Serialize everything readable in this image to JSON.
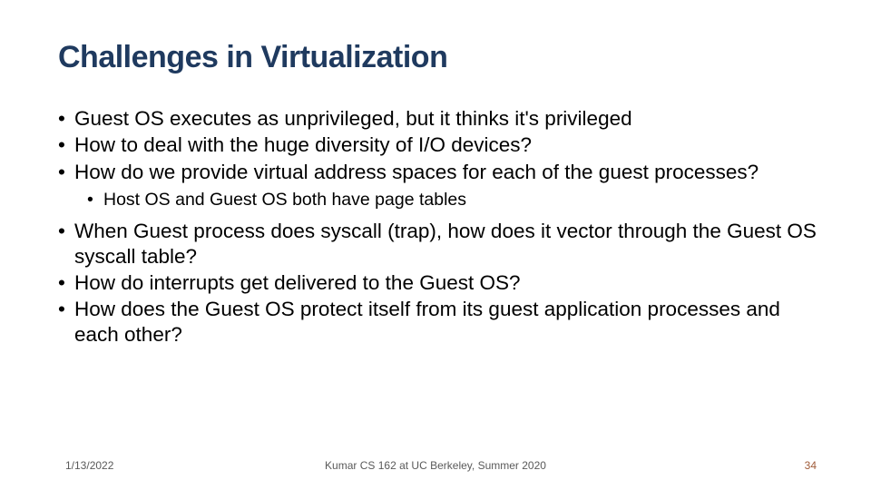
{
  "title": "Challenges in Virtualization",
  "bullets": {
    "b1": "Guest OS executes as unprivileged, but it thinks it's privileged",
    "b2": "How to deal with the huge diversity of I/O devices?",
    "b3": "How do we provide virtual address spaces for each of the guest processes?",
    "b3a": "Host OS and Guest OS both have page tables",
    "b4": "When Guest process does syscall (trap), how does it vector through the Guest OS syscall table?",
    "b5": "How do interrupts get delivered to the Guest OS?",
    "b6": "How does the Guest OS protect itself from its guest application processes and each other?"
  },
  "footer": {
    "date": "1/13/2022",
    "center": "Kumar CS 162 at UC Berkeley, Summer 2020",
    "pagenum": "34"
  }
}
